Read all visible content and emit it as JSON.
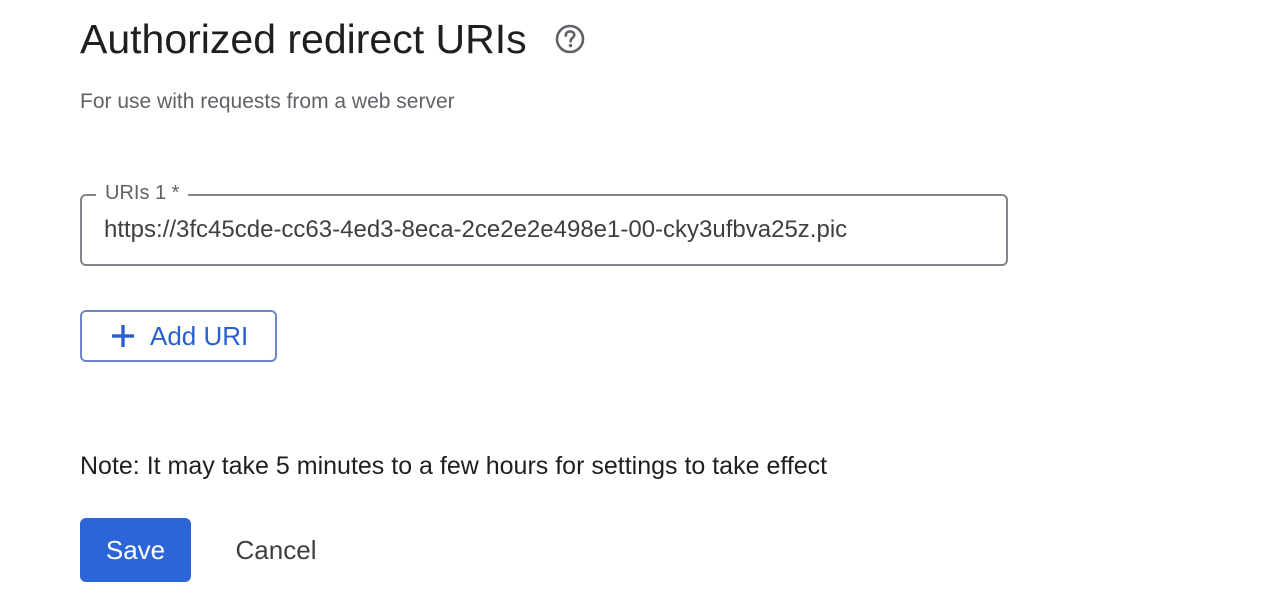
{
  "section": {
    "title": "Authorized redirect URIs",
    "help_icon": "help-circle-icon",
    "subtitle": "For use with requests from a web server"
  },
  "uri_field": {
    "label": "URIs 1 *",
    "value": "https://3fc45cde-cc63-4ed3-8eca-2ce2e2e498e1-00-cky3ufbva25z.pic"
  },
  "add_uri": {
    "icon": "plus-icon",
    "label": "Add URI"
  },
  "note": "Note: It may take 5 minutes to a few hours for settings to take effect",
  "actions": {
    "save_label": "Save",
    "cancel_label": "Cancel"
  },
  "colors": {
    "accent": "#2d64d8",
    "link_text": "#2a5fcf",
    "outline": "#80868b"
  }
}
